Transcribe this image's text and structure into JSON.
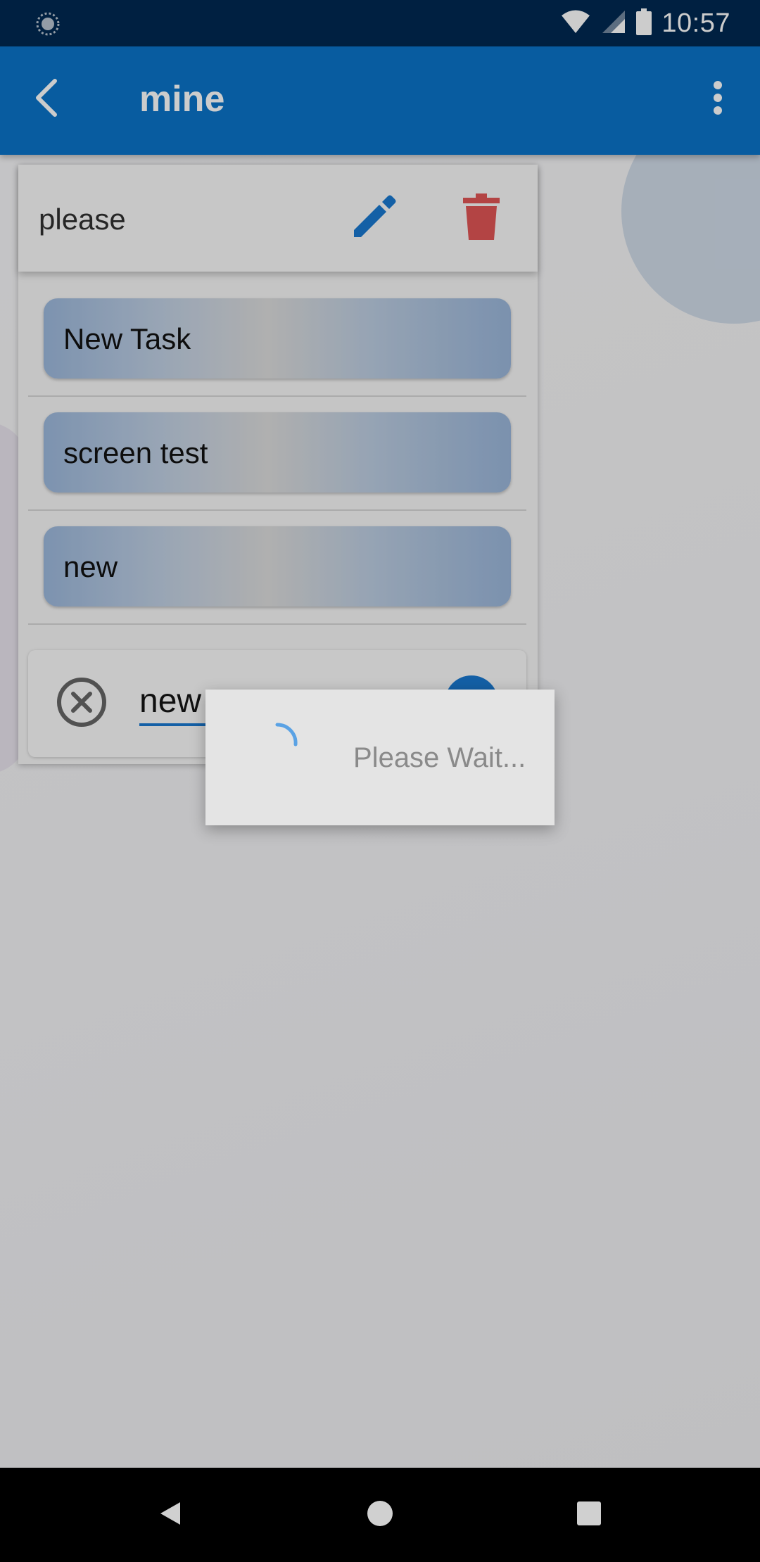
{
  "status_bar": {
    "time": "10:57",
    "icons": [
      "sync-icon",
      "wifi-icon",
      "signal-icon",
      "battery-icon"
    ]
  },
  "app_bar": {
    "title": "mine",
    "back_icon": "chevron-left-icon",
    "menu_icon": "more-vertical-icon",
    "background_color": "#0a74c8"
  },
  "list": {
    "name": "please",
    "edit_icon": "pencil-icon",
    "delete_icon": "trash-icon",
    "edit_color": "#1a78d0",
    "delete_color": "#e05555",
    "tasks": [
      {
        "label": "New Task"
      },
      {
        "label": "screen test"
      },
      {
        "label": "new"
      }
    ]
  },
  "new_task_editor": {
    "value": "new",
    "cancel_icon": "close-circle-icon",
    "confirm_icon": "check-circle-icon"
  },
  "loading_dialog": {
    "message": "Please Wait..."
  },
  "nav_bar": {
    "back_icon": "triangle-back-icon",
    "home_icon": "circle-home-icon",
    "recents_icon": "square-recents-icon"
  }
}
